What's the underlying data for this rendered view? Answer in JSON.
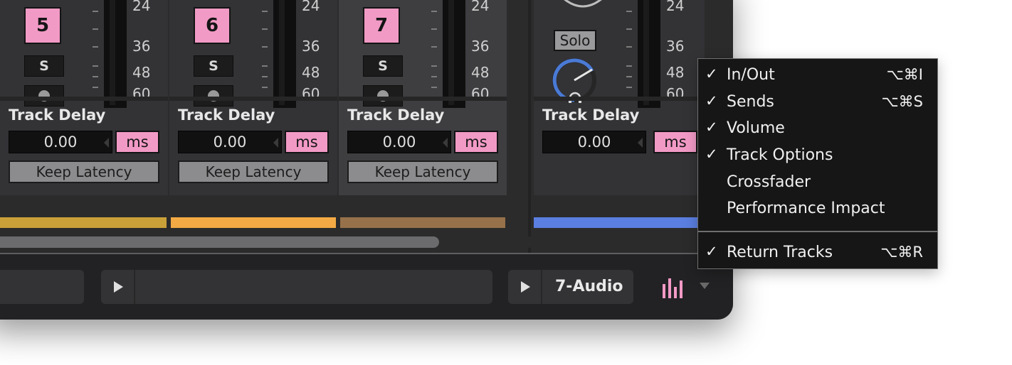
{
  "tracks": [
    {
      "number": "5",
      "solo": "S",
      "delay_label": "Track Delay",
      "delay_value": "0.00",
      "unit": "ms",
      "keep": "Keep Latency",
      "color": "#caa038"
    },
    {
      "number": "6",
      "solo": "S",
      "delay_label": "Track Delay",
      "delay_value": "0.00",
      "unit": "ms",
      "keep": "Keep Latency",
      "color": "#f3aa44"
    },
    {
      "number": "7",
      "solo": "S",
      "delay_label": "Track Delay",
      "delay_value": "0.00",
      "unit": "ms",
      "keep": "Keep Latency",
      "color": "#96714a"
    }
  ],
  "meter_scale": [
    "24",
    "36",
    "48",
    "60"
  ],
  "master": {
    "solo_label": "Solo",
    "scale": [
      "24",
      "36",
      "48",
      "60"
    ],
    "delay_label": "Track Delay",
    "delay_value": "0.00",
    "unit": "ms",
    "color": "#5b7fe0",
    "knob_color": "#4a7ad6"
  },
  "bottom_bar": {
    "selected_track": "7-Audio",
    "mixer_icon": "mixer-bars-icon",
    "accent": "#f29ac6"
  },
  "menu": {
    "items": [
      {
        "check": "✓",
        "label": "In/Out",
        "shortcut": "⌥⌘I"
      },
      {
        "check": "✓",
        "label": "Sends",
        "shortcut": "⌥⌘S"
      },
      {
        "check": "✓",
        "label": "Volume",
        "shortcut": ""
      },
      {
        "check": "✓",
        "label": "Track Options",
        "shortcut": ""
      },
      {
        "check": "",
        "label": "Crossfader",
        "shortcut": ""
      },
      {
        "check": "",
        "label": "Performance Impact",
        "shortcut": ""
      },
      {
        "check": "✓",
        "label": "Return Tracks",
        "shortcut": "⌥⌘R"
      }
    ]
  }
}
